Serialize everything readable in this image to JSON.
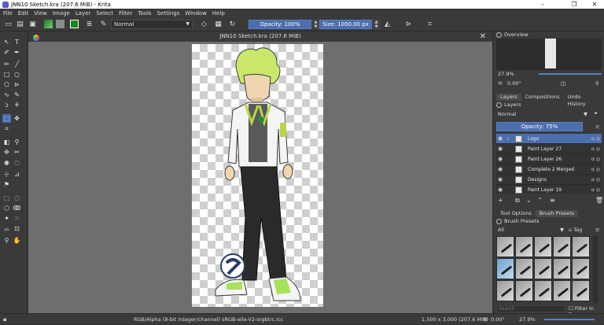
{
  "window": {
    "title": "JNN10 Sketch.kra (207.6 MiB) - Krita",
    "minimize": "–",
    "maximize": "❐",
    "close": "✕"
  },
  "menu": [
    "File",
    "Edit",
    "View",
    "Image",
    "Layer",
    "Select",
    "Filter",
    "Tools",
    "Settings",
    "Window",
    "Help"
  ],
  "toolbar": {
    "blend_mode": "Normal",
    "opacity_label": "Opacity: 100%",
    "size_label": "Size: 1000.00 px"
  },
  "document": {
    "tab_title": "JNN10 Sketch.kra (207.6 MiB)",
    "close": "✕"
  },
  "overview": {
    "title": "Overview",
    "zoom": "27.9%",
    "rotation": "0.00°"
  },
  "layers_panel": {
    "tabs": [
      "Layers",
      "Compositions",
      "Undo History"
    ],
    "title": "Layers",
    "blend_mode": "Normal",
    "opacity_label": "Opacity: 75%",
    "layers": [
      {
        "name": "Logo",
        "selected": true
      },
      {
        "name": "Paint Layer 27",
        "selected": false
      },
      {
        "name": "Paint Layer 26",
        "selected": false
      },
      {
        "name": "Complete 2 Merged",
        "selected": false
      },
      {
        "name": "Designs",
        "selected": false
      },
      {
        "name": "Paint Layer 19",
        "selected": false
      }
    ]
  },
  "presets_panel": {
    "tabs": [
      "Tool Options",
      "Brush Presets"
    ],
    "title": "Brush Presets",
    "filter": "All",
    "tag_label": "Tag",
    "search_placeholder": "Search",
    "filter_in_tag": "Filter in Tag"
  },
  "status": {
    "color_info": "RGB/Alpha (8-bit integer/channel)  sRGB-elle-V2-srgbtrc.icc",
    "dimensions": "1,500 x 3,000 (207.6 MiB)",
    "rotation": "0.00°",
    "zoom": "27.9%"
  },
  "colors": {
    "accent": "#4b6eaf",
    "panel": "#3a3a3a",
    "canvas_bg": "#6e6e6e"
  }
}
